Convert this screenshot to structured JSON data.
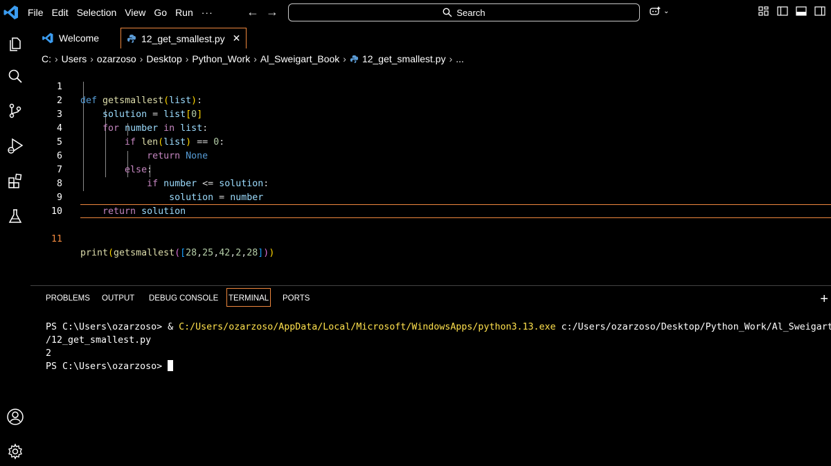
{
  "menu": [
    "File",
    "Edit",
    "Selection",
    "View",
    "Go",
    "Run",
    "···"
  ],
  "search": {
    "label": "Search"
  },
  "tabs": {
    "welcome": "Welcome",
    "active": "12_get_smallest.py",
    "close": "✕"
  },
  "breadcrumb": [
    "C:",
    "Users",
    "ozarzoso",
    "Desktop",
    "Python_Work",
    "Al_Sweigart_Book",
    "12_get_smallest.py",
    "..."
  ],
  "editor": {
    "line_numbers": [
      "1",
      "2",
      "3",
      "4",
      "5",
      "6",
      "7",
      "8",
      "9",
      "10",
      "11"
    ],
    "current_line": 11
  },
  "panel": {
    "tabs": [
      "PROBLEMS",
      "OUTPUT",
      "DEBUG CONSOLE",
      "TERMINAL",
      "PORTS"
    ],
    "active_tab": "TERMINAL"
  },
  "terminal": {
    "prompt": "PS C:\\Users\\ozarzoso> ",
    "amp": "& ",
    "exe": "C:/Users/ozarzoso/AppData/Local/Microsoft/WindowsApps/python3.13.exe",
    "script_a": " c:/Users/ozarzoso/Desktop/Python_Work/Al_Sweigart_Book",
    "script_b": "/12_get_smallest.py",
    "output": "2",
    "prompt2": "PS C:\\Users\\ozarzoso> "
  },
  "colors": {
    "accent": "#f0883e",
    "keyword": "#569cd6",
    "control": "#c586c0",
    "function": "#dcdcaa",
    "variable": "#9cdcfe",
    "number": "#b5cea8",
    "terminal_path": "#ffe14d"
  }
}
